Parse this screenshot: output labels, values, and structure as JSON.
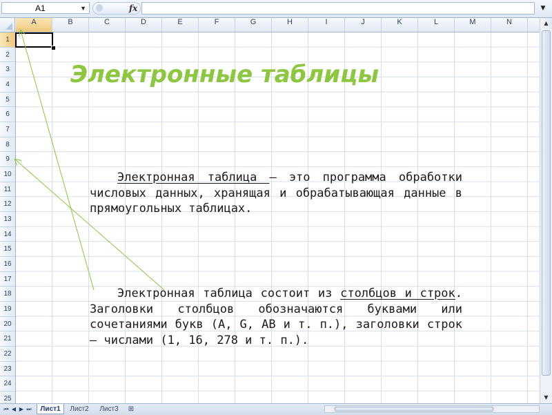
{
  "app": {
    "name_box": "A1",
    "formula_icon": "fx",
    "formula_value": ""
  },
  "columns": [
    "A",
    "B",
    "C",
    "D",
    "E",
    "F",
    "G",
    "H",
    "I",
    "J",
    "K",
    "L",
    "M",
    "N"
  ],
  "rows": [
    "1",
    "2",
    "3",
    "4",
    "5",
    "6",
    "7",
    "8",
    "9",
    "10",
    "11",
    "12",
    "13",
    "14",
    "15",
    "16",
    "17",
    "18",
    "19",
    "20",
    "21",
    "22",
    "23",
    "24",
    "25"
  ],
  "active_cell": {
    "column": "A",
    "row": "1"
  },
  "sheets": {
    "tabs": [
      "Лист1",
      "Лист2",
      "Лист3"
    ],
    "active": "Лист1",
    "nav_icons": [
      "first-sheet-icon",
      "prev-sheet-icon",
      "next-sheet-icon",
      "last-sheet-icon"
    ],
    "insert_icon": "insert-sheet-icon"
  },
  "content": {
    "title": "Электронные таблицы",
    "para1": {
      "term": "Электронная таблица ",
      "rest": "— это программа обработки числовых данных, хранящая и обрабатывающая данные в прямоугольных таблицах."
    },
    "para2": {
      "lead": "Электронная таблица состоит из ",
      "term_cols": "столбцов и строк",
      "rest": ". Заголовки столбцов обозначаются буквами или сочетаниями букв (A, G, AB и т. п.), заголовки строк — числами (1, 16, 278 и т. п.)."
    }
  },
  "colors": {
    "title": "#8dc63f",
    "arrows": "#8dc63f",
    "header_bg": "#e2eaf5",
    "active_header": "#f3c77a"
  }
}
